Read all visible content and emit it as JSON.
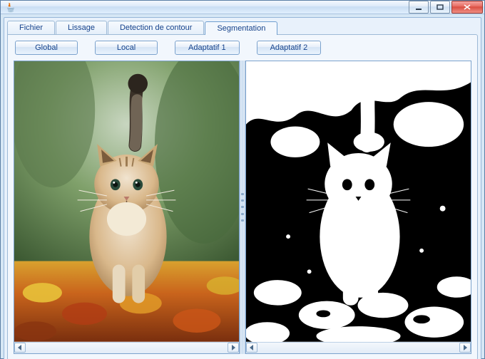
{
  "window": {
    "title": ""
  },
  "tabs": [
    {
      "label": "Fichier"
    },
    {
      "label": "Lissage"
    },
    {
      "label": "Detection de contour"
    },
    {
      "label": "Segmentation"
    }
  ],
  "active_tab": 3,
  "buttons": [
    {
      "label": "Global"
    },
    {
      "label": "Local"
    },
    {
      "label": "Adaptatif 1"
    },
    {
      "label": "Adaptatif 2"
    }
  ],
  "panes": {
    "left": {
      "desc": "original-color-image"
    },
    "right": {
      "desc": "segmented-binary-image"
    }
  }
}
